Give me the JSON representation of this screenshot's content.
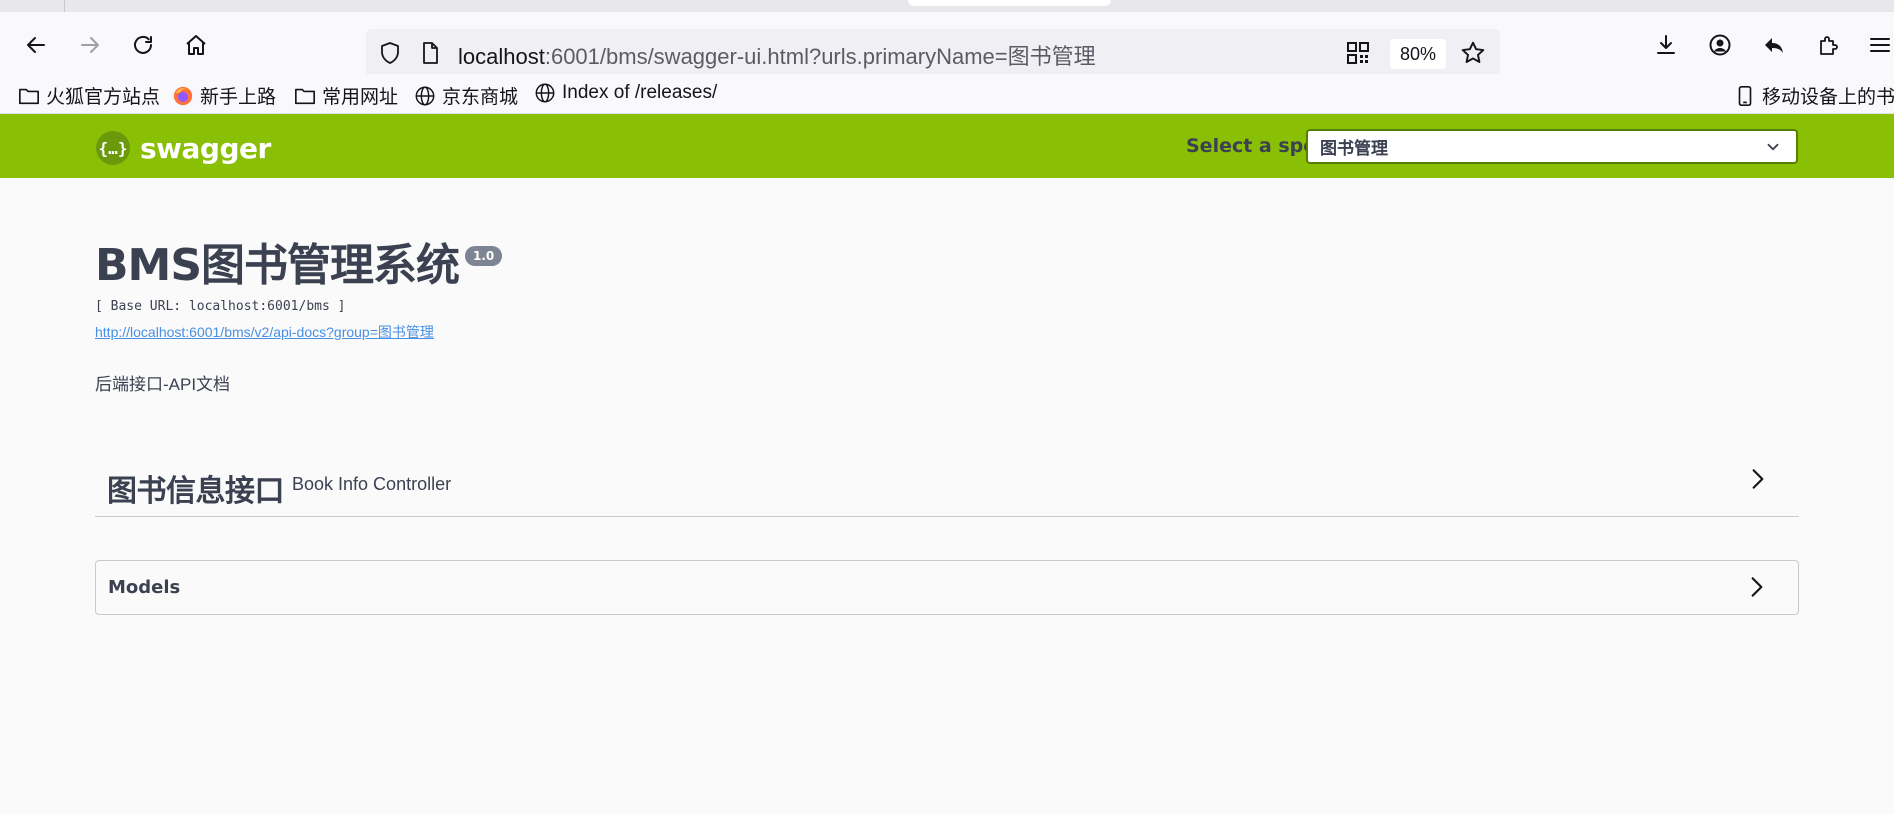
{
  "browser": {
    "url_host": "localhost",
    "url_rest": ":6001/bms/swagger-ui.html?urls.primaryName=图书管理",
    "zoom": "80%",
    "bookmarks": [
      {
        "label": "火狐官方站点"
      },
      {
        "label": "新手上路"
      },
      {
        "label": "常用网址"
      },
      {
        "label": "京东商城"
      },
      {
        "label": "Index of /releases/"
      }
    ],
    "mobile_bookmarks": "移动设备上的书签"
  },
  "swagger": {
    "logo_text": "swagger",
    "logo_symbol": "{…}",
    "spec_label": "Select a spec",
    "spec_selected": "图书管理",
    "accent": "#89bf04"
  },
  "info": {
    "title": "BMS图书管理系统",
    "version": "1.0",
    "base_url": "[ Base URL: localhost:6001/bms ]",
    "api_docs_link": "http://localhost:6001/bms/v2/api-docs?group=图书管理",
    "description": "后端接口-API文档"
  },
  "tags": [
    {
      "name": "图书信息接口",
      "description": "Book Info Controller"
    }
  ],
  "models": {
    "label": "Models"
  }
}
